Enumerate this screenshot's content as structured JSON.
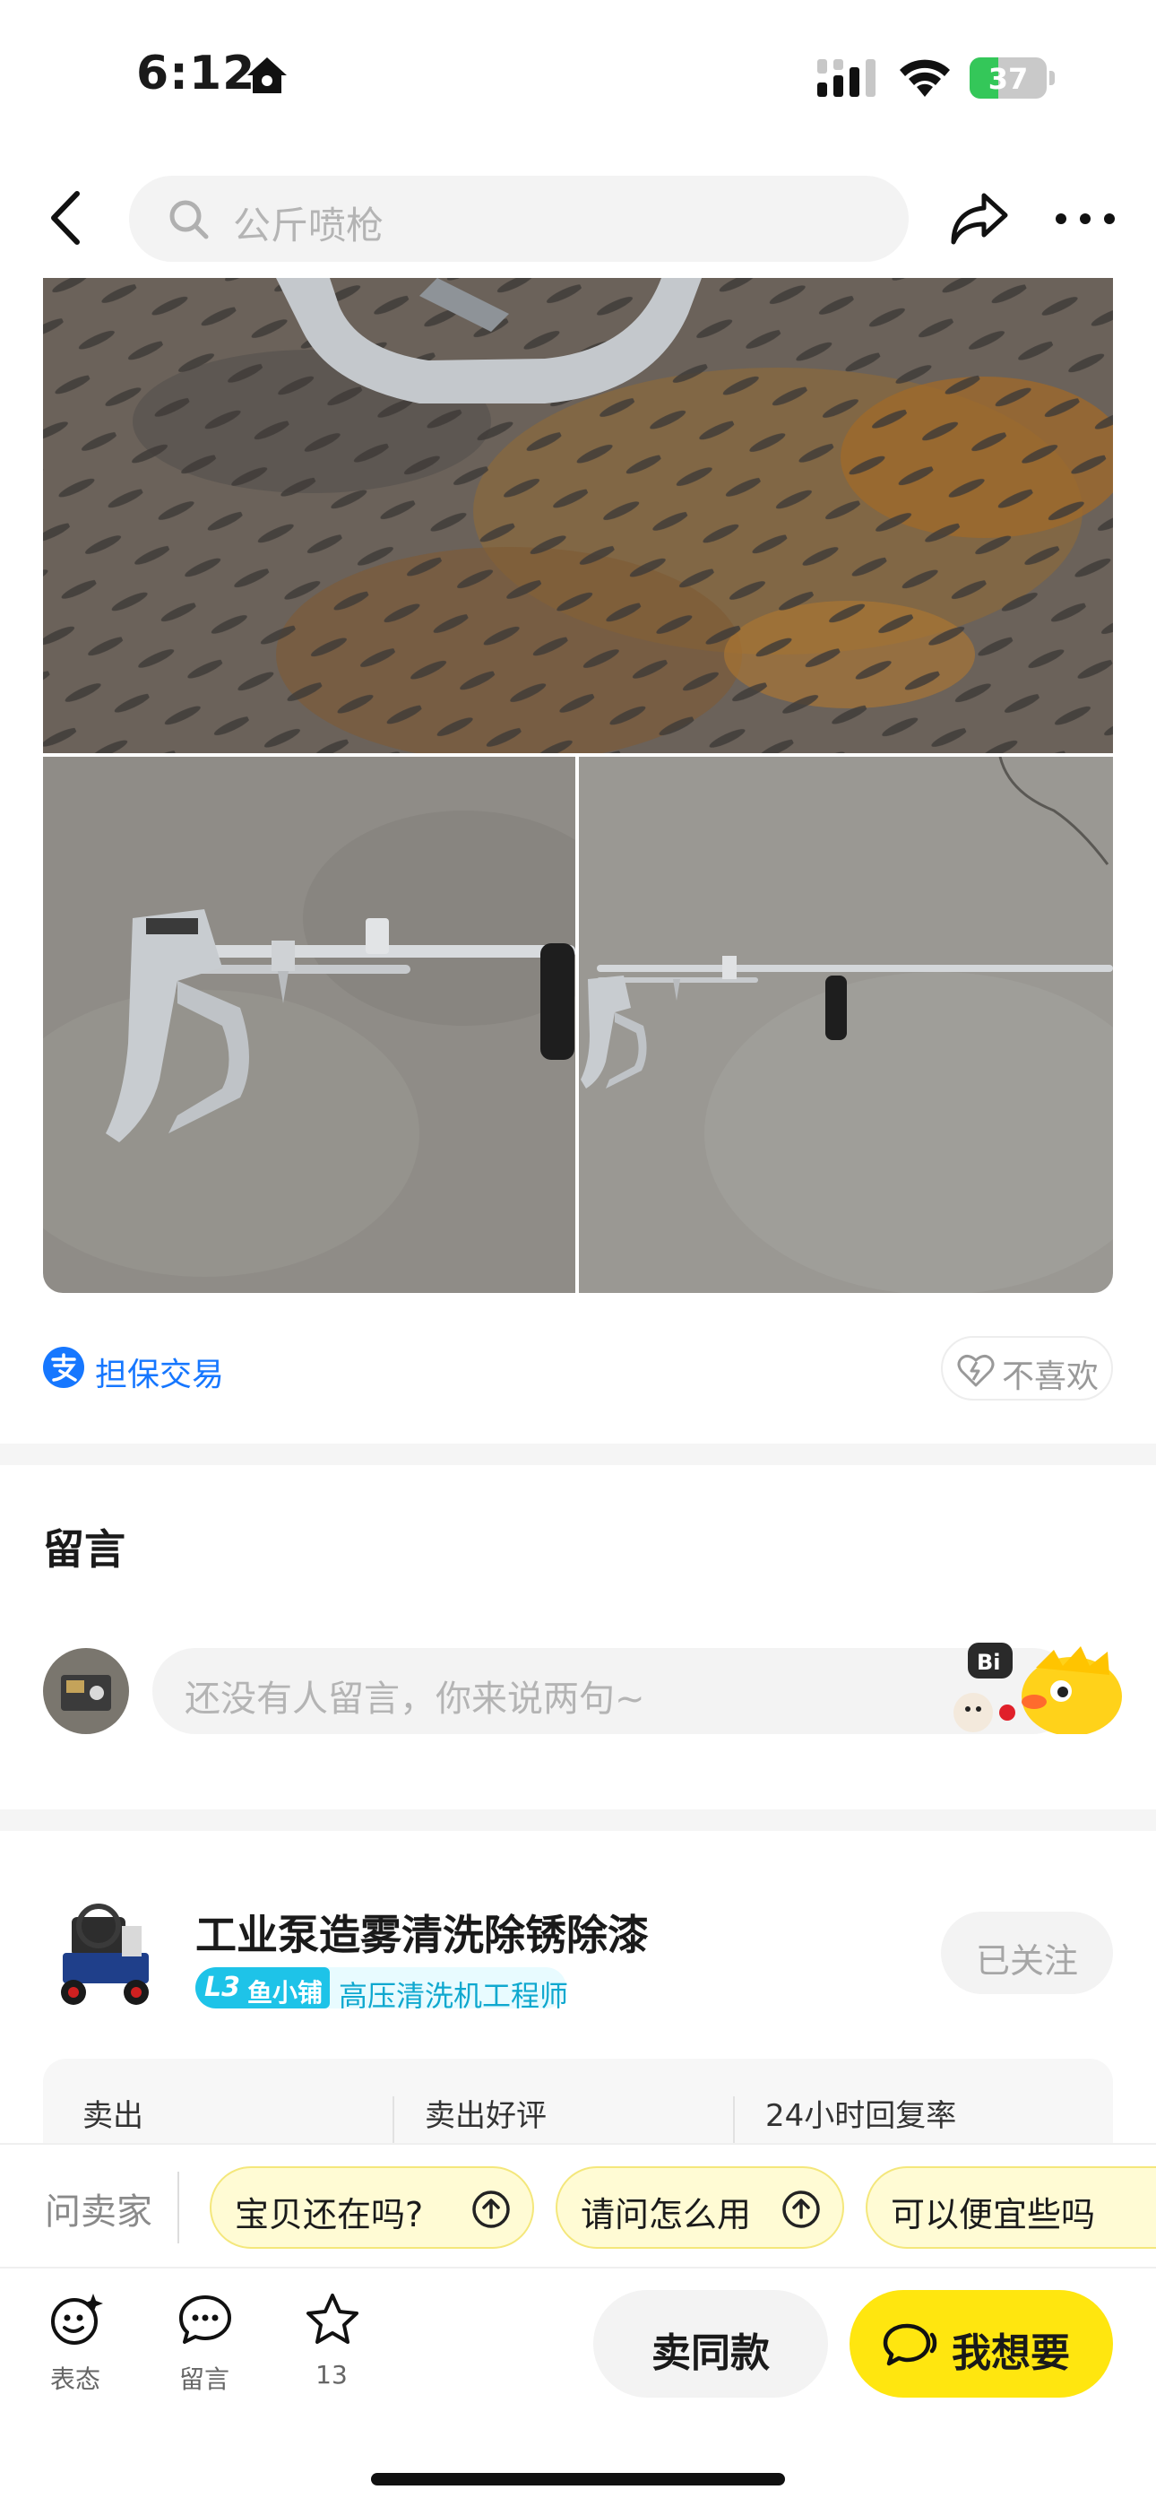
{
  "status_bar": {
    "time": "6:12",
    "battery_percent": "37",
    "battery_level": 0.37,
    "icons": [
      "home-icon",
      "signal-icon",
      "wifi-icon",
      "battery-charging-icon"
    ]
  },
  "nav": {
    "search_placeholder": "公斤喷枪",
    "icons": [
      "back-icon",
      "search-icon",
      "share-icon",
      "more-icon"
    ]
  },
  "product_images": [
    "rusty-floor-spray-gun",
    "spray-gun-on-concrete",
    "long-lance-spray-gun-on-concrete"
  ],
  "guarantee": {
    "label": "担保交易",
    "dislike_label": "不喜欢"
  },
  "comments": {
    "title": "留言",
    "placeholder": "还没有人留言，你来说两句~"
  },
  "seller": {
    "name": "工业泵造雾清洗除锈除漆",
    "level": "L3",
    "shop_label": "鱼小铺",
    "title": "高压清洗机工程师",
    "follow_label": "已关注",
    "stats": [
      "卖出",
      "卖出好评",
      "24小时回复率"
    ]
  },
  "quick_questions": {
    "label": "问卖家",
    "chips": [
      "宝贝还在吗?",
      "请问怎么用",
      "可以便宜些吗"
    ]
  },
  "toolbar": {
    "react_label": "表态",
    "comment_label": "留言",
    "favorite_count": "13",
    "sell_same_label": "卖同款",
    "want_label": "我想要"
  },
  "colors": {
    "accent_yellow": "#ffe60f",
    "link_blue": "#1677ff",
    "chip_bg": "#fffbd4",
    "level_cyan": "#1ec3e8"
  }
}
